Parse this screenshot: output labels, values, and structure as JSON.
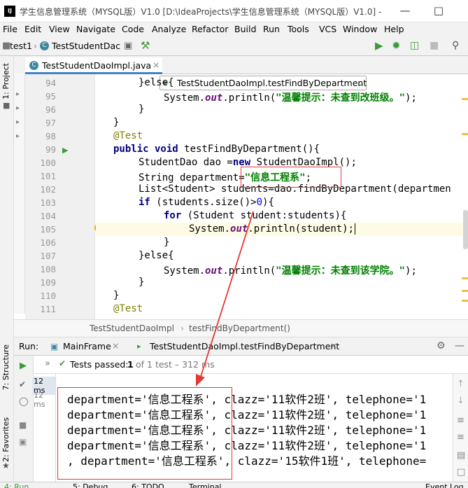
{
  "window": {
    "title": "学生信息管理系统（MYSQL版）V1.0 [D:\\IdeaProjects\\学生信息管理系统（MYSQL版）V1.0] -",
    "logo": "IJ"
  },
  "menu": [
    "File",
    "Edit",
    "View",
    "Navigate",
    "Code",
    "Analyze",
    "Refactor",
    "Build",
    "Run",
    "Tools",
    "VCS",
    "Window",
    "Help"
  ],
  "nav": {
    "project": "test1",
    "file": "TestStudentDac",
    "run_config": "TestStudentDaoImpl.testFindByDepartment"
  },
  "side_tabs": {
    "project": "1: Project",
    "structure": "7: Structure",
    "favorites": "2: Favorites"
  },
  "editor": {
    "tab": "TestStudentDaoImpl.java",
    "line_numbers": [
      "94",
      "95",
      "96",
      "97",
      "98",
      "99",
      "100",
      "101",
      "102",
      "103",
      "104",
      "105",
      "106",
      "107",
      "108",
      "109",
      "110",
      "111"
    ],
    "code": {
      "l94_else": "}else{",
      "l95_sys": "System.",
      "l95_out": "out",
      "l95_println": ".println(",
      "l95_str": "\"温馨提示：未查到改班级。\"",
      "l95_end": ");",
      "l96": "}",
      "l97": "}",
      "l98": "@Test",
      "l99_kw": "public void",
      "l99_rest": " testFindByDepartment(){",
      "l100_a": "StudentDao dao =",
      "l100_new": "new",
      "l100_b": " StudentDaoImpl();",
      "l101_a": "String department=",
      "l101_str": "\"信息工程系\"",
      "l101_b": ";",
      "l102": "List<Student> students=dao.findByDepartment(departmen",
      "l103_if": "if",
      "l103_a": " (students.size()>",
      "l103_num": "0",
      "l103_b": "){",
      "l104_for": "for",
      "l104_rest": " (Student student:students){",
      "l105_sys": "System.",
      "l105_out": "out",
      "l105_rest": ".println(student);",
      "l106": "}",
      "l107_else": "}else{",
      "l108_sys": "System.",
      "l108_out": "out",
      "l108_println": ".println(",
      "l108_str": "\"温馨提示：未查到该学院。\"",
      "l108_end": ");",
      "l109": "}",
      "l110": "}",
      "l111": "@Test"
    }
  },
  "breadcrumbs": [
    "TestStudentDaoImpl",
    "testFindByDepartment()"
  ],
  "run": {
    "label": "Run:",
    "tab_main": "MainFrame",
    "tab_test": "TestStudentDaoImpl.testFindByDepartment",
    "status": "Tests passed:",
    "passed_count": "1",
    "status_detail": "of 1 test – 312 ms",
    "time_top": "12 ms",
    "time_item": "12 ms",
    "output": [
      "department='信息工程系', clazz='11软件2班', telephone='1",
      "department='信息工程系', clazz='11软件2班', telephone='1",
      "department='信息工程系', clazz='11软件2班', telephone='1",
      "department='信息工程系', clazz='11软件2班', telephone='1",
      ", department='信息工程系', clazz='15软件1班', telephone="
    ]
  },
  "statusbar": {
    "run": "4: Run",
    "debug": "5: Debug",
    "todo": "6: TODO",
    "terminal": "Terminal",
    "event_log": "Event Log"
  },
  "colors": {
    "annotation_red": "#e53935",
    "keyword": "#000080",
    "string": "#008000",
    "run_green": "#3c9a3c"
  }
}
